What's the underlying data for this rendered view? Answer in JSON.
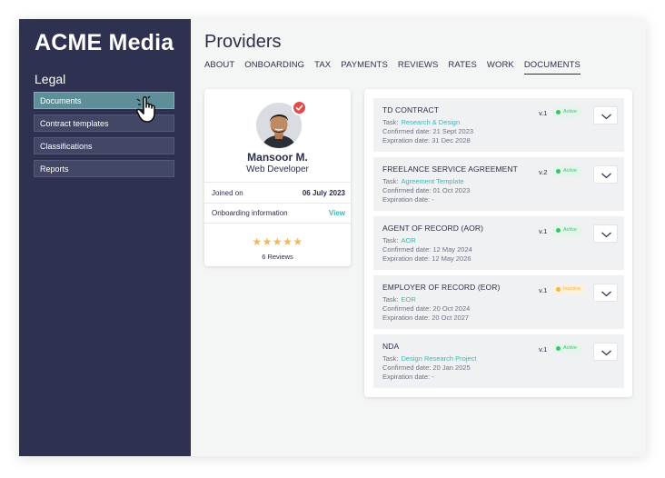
{
  "sidebar": {
    "brand": "ACME Media",
    "section_title": "Legal",
    "items": [
      {
        "label": "Documents",
        "active": true
      },
      {
        "label": "Contract templates"
      },
      {
        "label": "Classifications"
      },
      {
        "label": "Reports"
      }
    ]
  },
  "main": {
    "title": "Providers",
    "tabs": [
      "ABOUT",
      "ONBOARDING",
      "TAX",
      "PAYMENTS",
      "REVIEWS",
      "RATES",
      "WORK",
      "DOCUMENTS"
    ],
    "active_tab": "DOCUMENTS"
  },
  "profile": {
    "name": "Mansoor M.",
    "role": "Web Developer",
    "joined_label": "Joined on",
    "joined_value": "06 July 2023",
    "onboarding_label": "Onboarding information",
    "onboarding_link": "View",
    "rating_stars": 5,
    "reviews": "6 Reviews"
  },
  "documents": [
    {
      "title": "TD CONTRACT",
      "version": "v.1",
      "status": "Active",
      "task_label": "Task:",
      "task": "Research & Design",
      "confirmed": "Confirmed date:  21 Sept 2023",
      "expiration": "Expiration date: 31 Dec 2028"
    },
    {
      "title": "FREELANCE SERVICE AGREEMENT",
      "version": "v.2",
      "status": "Active",
      "task_label": "Task:",
      "task": "Agreement Template",
      "confirmed": "Confirmed date:  01 Oct 2023",
      "expiration": "Expiration date: -"
    },
    {
      "title": "AGENT OF RECORD (AOR)",
      "version": "v.1",
      "status": "Active",
      "task_label": "Task:",
      "task": "AOR",
      "confirmed": "Confirmed date:  12 May 2024",
      "expiration": "Expiration date: 12 May 2026"
    },
    {
      "title": "EMPLOYER OF RECORD (EOR)",
      "version": "v.1",
      "status": "Inactive",
      "task_label": "Task:",
      "task": "EOR",
      "confirmed": "Confirmed date:  20 Oct 2024",
      "expiration": "Expiration date: 20 Oct 2027"
    },
    {
      "title": "NDA",
      "version": "v.1",
      "status": "Active",
      "task_label": "Task:",
      "task": "Design Research Project",
      "confirmed": "Confirmed date:  20 Jan 2025",
      "expiration": "Expiration date: -"
    }
  ],
  "colors": {
    "sidebar": "#2e3150",
    "active_nav": "#5e8e97",
    "accent": "#3cb6b5",
    "active_badge_bg": "#e3f5ea",
    "active_badge_dot": "#3fbf6e",
    "inactive_badge_bg": "#fdf0dc",
    "inactive_badge_dot": "#f0b34e",
    "star": "#f3b65b",
    "verified": "#e34b4b"
  },
  "icons": {
    "cursor": "hand-pointer-icon",
    "verified": "verified-check-icon",
    "expand": "chevron-down-icon"
  }
}
